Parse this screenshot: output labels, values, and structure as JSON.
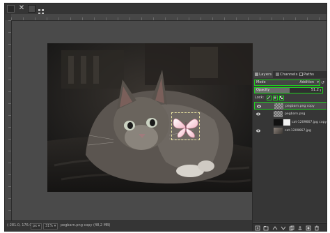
{
  "status_bar": {
    "coords": "(-281.0, 176.0)",
    "unit": "px",
    "zoom": "31%",
    "layer_info": "pegbarn.png copy (48,2 MB)"
  },
  "dock": {
    "tabs": [
      "Layers",
      "Channels",
      "Paths"
    ],
    "mode_label": "Mode",
    "mode_value": "Addition",
    "opacity_label": "Opacity",
    "opacity_value": "51.2",
    "opacity_fraction": 0.512,
    "lock_label": "Lock:",
    "layers": [
      {
        "name": "pegbarn.png copy",
        "visible": true,
        "selected": true,
        "thumb": "checker"
      },
      {
        "name": "pegbarn.png",
        "visible": true,
        "selected": false,
        "thumb": "checker"
      },
      {
        "name": "cat-1209667.jpg copy",
        "visible": false,
        "selected": false,
        "thumb": "white-black"
      },
      {
        "name": "cat-1209667.jpg",
        "visible": true,
        "selected": false,
        "thumb": "photo"
      }
    ]
  },
  "colors": {
    "highlight": "#1fd21f",
    "window_bg": "#3c3c3c"
  }
}
